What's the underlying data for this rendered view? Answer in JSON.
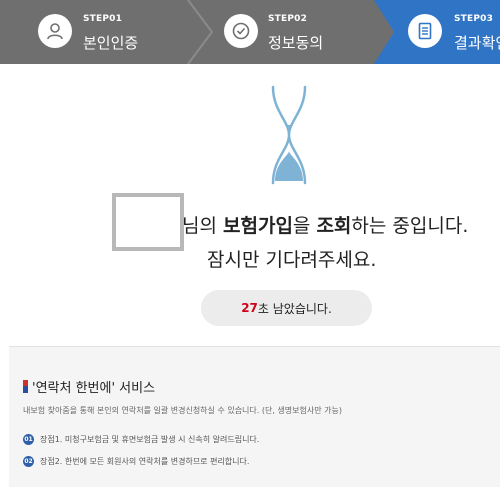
{
  "steps": [
    {
      "num": "STEP01",
      "name": "본인인증",
      "icon": "person-icon",
      "state": "done"
    },
    {
      "num": "STEP02",
      "name": "정보동의",
      "icon": "check-circle-icon",
      "state": "done"
    },
    {
      "num": "STEP03",
      "name": "결과확인",
      "icon": "document-icon",
      "state": "active"
    }
  ],
  "colors": {
    "step_inactive": "#6f6f6f",
    "step_active": "#2f74c5",
    "hourglass": "#7fb3d5",
    "countdown": "#d0021b",
    "badge": "#2f5fa8"
  },
  "main": {
    "hourglass_icon": "hourglass-icon",
    "message_part1": "님의 ",
    "message_part2": "보험가입",
    "message_part3": "을 ",
    "message_part4": "조회",
    "message_part5": "하는 중입니다.",
    "message_line2": "잠시만 기다려주세요.",
    "countdown_seconds": "27",
    "countdown_suffix": "초 남았습니다."
  },
  "service": {
    "title": "'연락처 한번에' 서비스",
    "description": "내보험 찾아줌을 통해 본인의 연락처를 일괄 변경신청하실 수 있습니다. (단, 생명보험사만 가능)",
    "items": [
      {
        "badge": "01",
        "text": "장점1. 미청구보험금 및 휴면보험금 발생 시 신속히 알려드립니다."
      },
      {
        "badge": "02",
        "text": "장점2. 한번에 모든 회원사의 연락처를 변경하므로 편리합니다."
      }
    ]
  }
}
